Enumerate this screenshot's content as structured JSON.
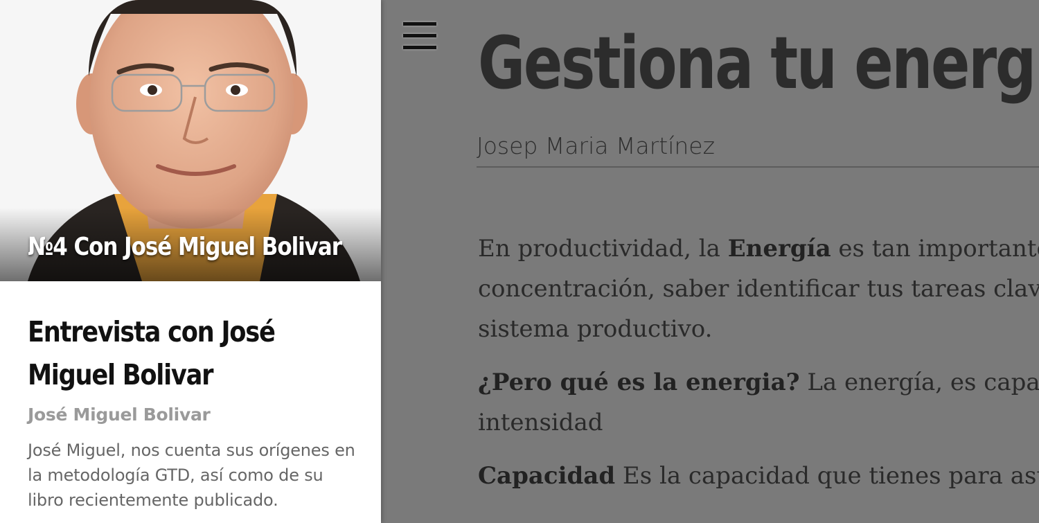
{
  "drawer": {
    "hero_caption": "№4 Con José Miguel Bolivar",
    "card_title": "Entrevista con José Miguel Bolivar",
    "card_author": "José Miguel Bolivar",
    "card_description": "José Miguel, nos cuenta sus orígenes en la metodología GTD, así como de su libro recientemente publicado."
  },
  "article": {
    "title": "Gestiona tu energía",
    "author": "Josep Maria Martínez",
    "p1_pre": "En productividad, la ",
    "p1_bold": "Energía",
    "p1_line1_rest": " es tan importante co",
    "p1_line2": "concentración, saber identificar tus tareas clave, o",
    "p1_line3": "sistema productivo.",
    "p2_bold": "¿Pero qué es la energia?",
    "p2_line1_rest": " La energía, es capacid",
    "p2_line2": "intensidad",
    "p3_bold": "Capacidad",
    "p3_line1_rest": " Es la capacidad que tienes para asumi"
  },
  "icons": {
    "menu": "hamburger-menu-icon"
  },
  "colors": {
    "overlay": "#7a7a7a",
    "drawer_bg": "#ffffff",
    "author_gray": "#9a9a9a"
  }
}
